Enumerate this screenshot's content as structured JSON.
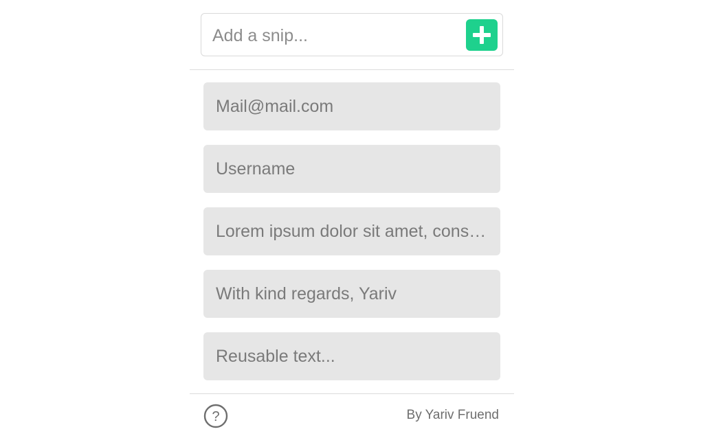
{
  "add_bar": {
    "placeholder": "Add a snip...",
    "add_icon": "plus-icon"
  },
  "snips": [
    {
      "text": "Mail@mail.com"
    },
    {
      "text": "Username"
    },
    {
      "text": "Lorem ipsum dolor sit amet, consectetur adipiscing elit"
    },
    {
      "text": "With kind regards, Yariv"
    },
    {
      "text": "Reusable text..."
    }
  ],
  "footer": {
    "help_icon": "question-circle-icon",
    "credit": "By Yariv Fruend"
  },
  "colors": {
    "accent": "#1ed18d",
    "snip_background": "#e6e6e6"
  }
}
